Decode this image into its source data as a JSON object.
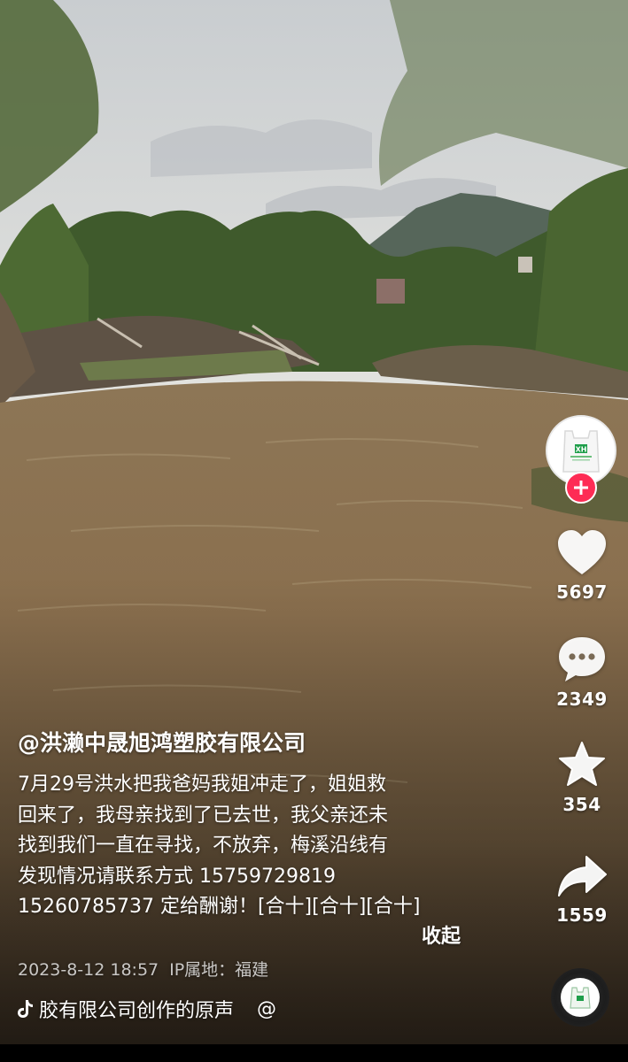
{
  "profile": {
    "avatar_icon": "bag-logo-icon",
    "avatar_text": "XH",
    "follow_icon": "plus-icon"
  },
  "actions": {
    "like": {
      "icon": "heart-icon",
      "count": "5697"
    },
    "comment": {
      "icon": "comment-bubble-icon",
      "count": "2349"
    },
    "favorite": {
      "icon": "star-icon",
      "count": "354"
    },
    "share": {
      "icon": "share-arrow-icon",
      "count": "1559"
    }
  },
  "post": {
    "author": "@洪濑中晟旭鸿塑胶有限公司",
    "caption_lines": [
      "7月29号洪水把我爸妈我姐冲走了，姐姐救",
      "回来了，我母亲找到了已去世，我父亲还未",
      "找到我们一直在寻找，不放弃，梅溪沿线有",
      "发现情况请联系方式 15759729819",
      "15260785737 定给酬谢！[合十][合十][合十]"
    ],
    "collapse_label": "收起",
    "date": "2023-8-12 18:57",
    "ip_location": "IP属地：福建"
  },
  "music": {
    "icon": "tiktok-note-icon",
    "title": "胶有限公司创作的原声",
    "at": "@"
  },
  "colors": {
    "accent": "#fe2c55",
    "water": "#8a6f4e",
    "foliage": "#3f5a2c"
  }
}
